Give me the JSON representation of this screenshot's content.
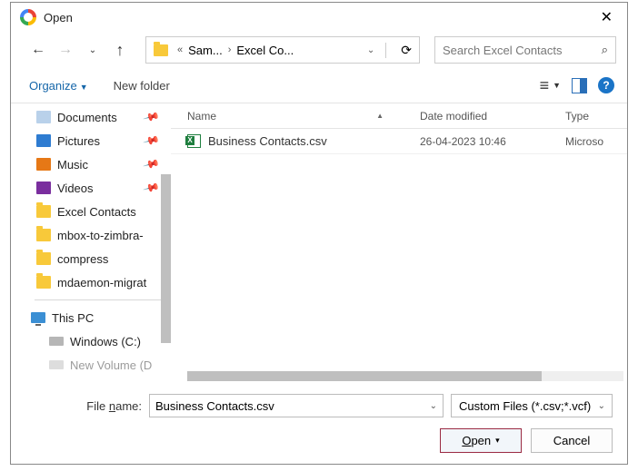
{
  "window": {
    "title": "Open"
  },
  "nav": {
    "breadcrumb": {
      "left_chev": "«",
      "seg1": "Sam...",
      "seg2": "Excel Co..."
    },
    "search_placeholder": "Search Excel Contacts"
  },
  "toolbar": {
    "organize": "Organize",
    "new_folder": "New folder"
  },
  "sidebar": {
    "items": [
      {
        "label": "Documents",
        "icon": "doc",
        "pinned": true
      },
      {
        "label": "Pictures",
        "icon": "pic",
        "pinned": true
      },
      {
        "label": "Music",
        "icon": "mus",
        "pinned": true
      },
      {
        "label": "Videos",
        "icon": "vid",
        "pinned": true
      },
      {
        "label": "Excel Contacts",
        "icon": "folder",
        "pinned": false
      },
      {
        "label": "mbox-to-zimbra-",
        "icon": "folder",
        "pinned": false
      },
      {
        "label": "compress",
        "icon": "folder",
        "pinned": false
      },
      {
        "label": "mdaemon-migrat",
        "icon": "folder",
        "pinned": false
      }
    ],
    "this_pc": "This PC",
    "drives": [
      {
        "label": "Windows (C:)"
      },
      {
        "label": "New Volume (D"
      }
    ]
  },
  "filelist": {
    "columns": {
      "name": "Name",
      "date": "Date modified",
      "type": "Type"
    },
    "rows": [
      {
        "name": "Business Contacts.csv",
        "date": "26-04-2023 10:46",
        "type": "Microso"
      }
    ]
  },
  "footer": {
    "filename_label": "File name:",
    "filename_value": "Business Contacts.csv",
    "filetype_value": "Custom Files (*.csv;*.vcf)",
    "open": "Open",
    "cancel": "Cancel"
  }
}
